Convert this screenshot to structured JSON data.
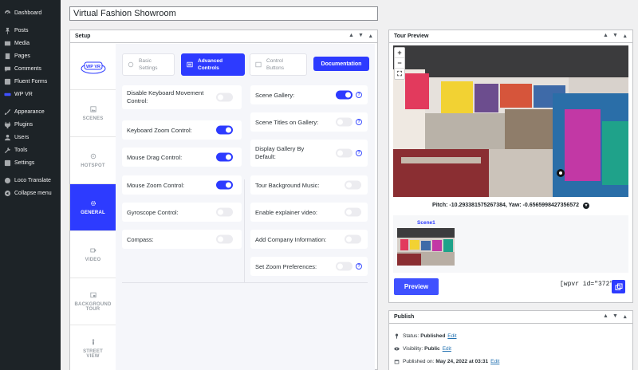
{
  "admin_menu": [
    {
      "label": "Dashboard",
      "icon": "dashboard-icon"
    },
    {
      "label": "Posts",
      "icon": "pin-icon"
    },
    {
      "label": "Media",
      "icon": "media-icon"
    },
    {
      "label": "Pages",
      "icon": "pages-icon"
    },
    {
      "label": "Comments",
      "icon": "comment-icon"
    },
    {
      "label": "Fluent Forms",
      "icon": "forms-icon"
    },
    {
      "label": "WP VR",
      "icon": "vr-icon"
    },
    {
      "label": "Appearance",
      "icon": "brush-icon"
    },
    {
      "label": "Plugins",
      "icon": "plugin-icon"
    },
    {
      "label": "Users",
      "icon": "user-icon"
    },
    {
      "label": "Tools",
      "icon": "wrench-icon"
    },
    {
      "label": "Settings",
      "icon": "settings-icon"
    },
    {
      "label": "Loco Translate",
      "icon": "translate-icon"
    },
    {
      "label": "Collapse menu",
      "icon": "collapse-icon"
    }
  ],
  "post_title": "Virtual Fashion Showroom",
  "setup": {
    "title": "Setup",
    "logo_text": "WP VR",
    "vtabs": [
      {
        "label": "SCENES",
        "active": false
      },
      {
        "label": "HOTSPOT",
        "active": false
      },
      {
        "label": "GENERAL",
        "active": true
      },
      {
        "label": "VIDEO",
        "active": false
      },
      {
        "label": "BACKGROUND TOUR",
        "active": false
      },
      {
        "label": "STREET VIEW",
        "active": false
      }
    ],
    "htabs": [
      {
        "label": "Basic Settings"
      },
      {
        "label": "Advanced Controls"
      },
      {
        "label": "Control Buttons"
      }
    ],
    "documentation_label": "Documentation",
    "left_options": [
      {
        "label": "Disable Keyboard Movement Control:",
        "on": false
      },
      {
        "label": "Keyboard Zoom Control:",
        "on": true
      },
      {
        "label": "Mouse Drag Control:",
        "on": true
      },
      {
        "label": "Mouse Zoom Control:",
        "on": true
      },
      {
        "label": "Gyroscope Control:",
        "on": false
      },
      {
        "label": "Compass:",
        "on": false
      }
    ],
    "right_options": [
      {
        "label": "Scene Gallery:",
        "on": true,
        "info": true
      },
      {
        "label": "Scene Titles on Gallery:",
        "on": false,
        "info": true
      },
      {
        "label": "Display Gallery By Default:",
        "on": false,
        "info": true
      },
      {
        "label": "Tour Background Music:",
        "on": false,
        "info": false
      },
      {
        "label": "Enable explainer video:",
        "on": false,
        "info": false
      },
      {
        "label": "Add Company Information:",
        "on": false,
        "info": false
      },
      {
        "label": "Set Zoom Preferences:",
        "on": false,
        "info": true
      }
    ],
    "info_glyph": "?"
  },
  "tour_preview": {
    "title": "Tour Preview",
    "zoom_in": "+",
    "zoom_out": "−",
    "fullscreen": "⛶",
    "pitch_yaw": "Pitch: -10.293381575267384, Yaw: -0.6565998427356572",
    "scene_label": "Scene1",
    "preview_label": "Preview",
    "shortcode": "[wpvr id=\"372\"]"
  },
  "publish": {
    "title": "Publish",
    "status_label": "Status:",
    "status_value": "Published",
    "visibility_label": "Visibility:",
    "visibility_value": "Public",
    "published_label": "Published on:",
    "published_value": "May 24, 2022 at 03:31",
    "edit": "Edit"
  },
  "colors": {
    "accent": "#2d3bff",
    "admin_bg": "#1d2327",
    "admin_active": "#2271b1"
  }
}
